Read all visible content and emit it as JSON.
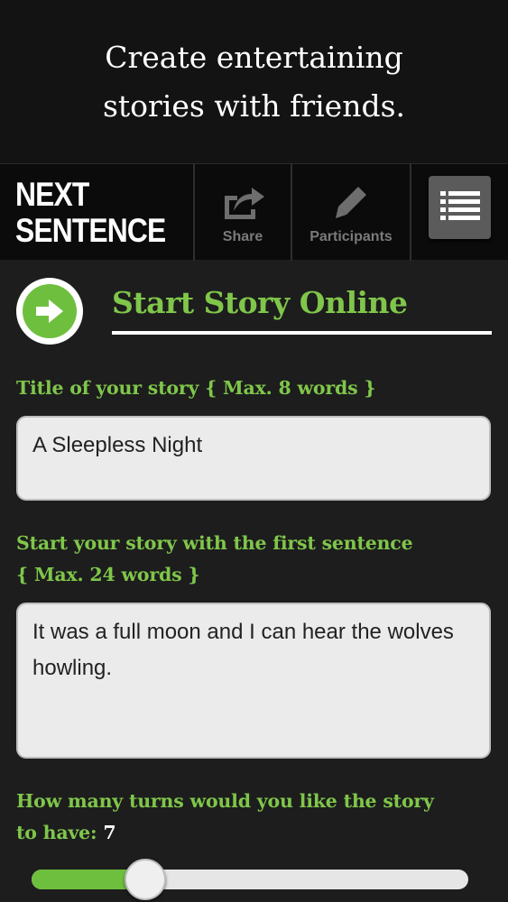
{
  "promo": {
    "line1": "Create entertaining",
    "line2": "stories with friends."
  },
  "appbar": {
    "logo_line1": "NEXT",
    "logo_line2": "SENTENCE",
    "share_label": "Share",
    "participants_label": "Participants",
    "share_icon": "share-icon",
    "participants_icon": "pencil-icon",
    "menu_icon": "list-menu-icon"
  },
  "section": {
    "title": "Start Story Online",
    "icon": "arrow-right-icon"
  },
  "form": {
    "title_label": "Title of your story { Max. 8 words }",
    "title_value": "A Sleepless Night",
    "sentence_label_line1": "Start your story with the first sentence",
    "sentence_label_line2": "{ Max. 24 words }",
    "sentence_value": "It was a full moon and I can hear the wolves howling.",
    "turns_label_line1": "How many turns would you like the story",
    "turns_label_line2": "to have: ",
    "turns_value": "7",
    "turns_fraction": 0.26
  },
  "colors": {
    "accent": "#7fc64a",
    "accent_dark": "#6fbf3e",
    "background": "#1d1d1d",
    "appbar": "#0b0b0b",
    "input_bg": "#ebebeb"
  }
}
